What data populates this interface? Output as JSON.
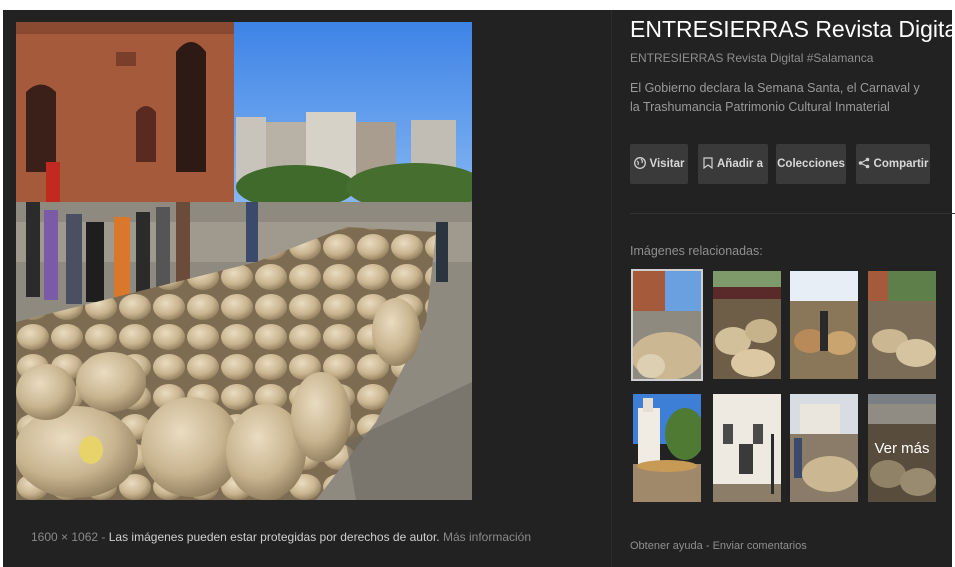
{
  "image": {
    "dimensions": "1600 × 1062",
    "separator": " - ",
    "copyright_notice": "Las imágenes pueden estar protegidas por derechos de autor.",
    "more_info": "Más información"
  },
  "result": {
    "title": "ENTRESIERRAS Revista Digital #S...",
    "site": "ENTRESIERRAS Revista Digital #Salamanca",
    "description": "El Gobierno declara la Semana Santa, el Carnaval y la Trashumancia Patrimonio Cultural Inmaterial"
  },
  "actions": {
    "visit": "Visitar",
    "add": "Añadir a",
    "collections": "Colecciones",
    "share": "Compartir"
  },
  "related": {
    "label": "Imágenes relacionadas:",
    "see_more": "Ver más"
  },
  "footer": {
    "help": "Obtener ayuda",
    "separator": "-",
    "feedback": "Enviar comentarios"
  },
  "icons": {
    "visit": "globe-icon",
    "add": "bookmark-icon",
    "share": "share-icon"
  }
}
